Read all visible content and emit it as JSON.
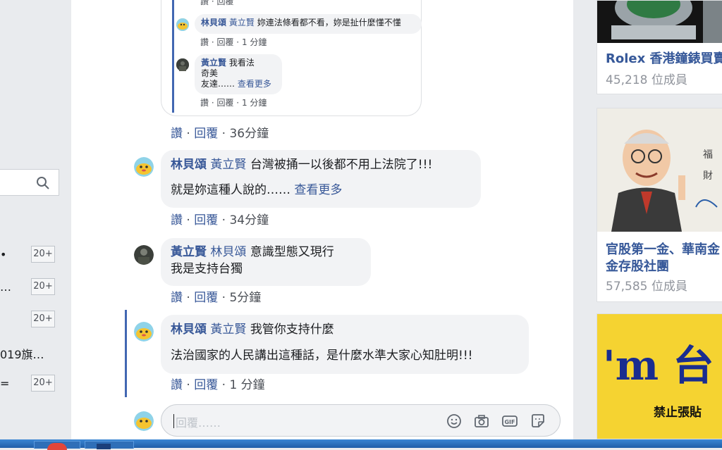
{
  "left_sidebar": {
    "rows": [
      {
        "text": "•",
        "badge": "20+"
      },
      {
        "text": "…",
        "badge": "20+"
      },
      {
        "text": "",
        "badge": "20+"
      },
      {
        "text": "019旗…",
        "badge": ""
      },
      {
        "text": "=",
        "badge": "20+"
      }
    ]
  },
  "nested_thread": {
    "reply1": {
      "author": "林貝頌",
      "tag": "黃立賢",
      "text": "妳連法條看都不看，妳是扯什麼懂不懂",
      "meta": {
        "like": "讚",
        "reply": "回覆",
        "time": "1 分鐘"
      }
    },
    "reply2": {
      "author": "黃立賢",
      "line1": "我看法",
      "line2": "奇美",
      "line3": "友達……",
      "more": "查看更多",
      "meta": {
        "like": "讚",
        "reply": "回覆",
        "time": "1 分鐘"
      }
    }
  },
  "thread_meta": {
    "like": "讚",
    "reply": "回覆",
    "time": "36分鐘"
  },
  "comments": [
    {
      "author": "林貝頌",
      "tag": "黃立賢",
      "line1": "台灣被捅一以後都不用上法院了!!!",
      "line2": "就是妳這種人說的……",
      "more": "查看更多",
      "meta": {
        "like": "讚",
        "reply": "回覆",
        "time": "34分鐘"
      }
    },
    {
      "author": "黃立賢",
      "tag": "林貝頌",
      "line1": "意識型態又現行",
      "line2": "我是支持台獨",
      "meta": {
        "like": "讚",
        "reply": "回覆",
        "time": "5分鐘"
      }
    },
    {
      "author": "林貝頌",
      "tag": "黃立賢",
      "line1": "我管你支持什麼",
      "line2": "法治國家的人民講出這種話，是什麼水準大家心知肚明!!!",
      "meta": {
        "like": "讚",
        "reply": "回覆",
        "time": "1 分鐘"
      }
    }
  ],
  "reply_box": {
    "placeholder": "回覆……",
    "icons": [
      "emoji-icon",
      "camera-icon",
      "gif-icon",
      "sticker-icon"
    ]
  },
  "groups": [
    {
      "title": "Rolex 香港鐘錶買賣",
      "members": "45,218 位成員"
    },
    {
      "title_line1": "官股第一金、華南金",
      "title_line2": "金存股社團",
      "members": "57,585 位成員"
    },
    {
      "banner_text": "'m 台",
      "banner_sub": "禁止張貼"
    }
  ],
  "colors": {
    "link": "#385898",
    "accent": "#4267b2",
    "bubble": "#f2f3f5",
    "meta": "#4b4f56"
  }
}
